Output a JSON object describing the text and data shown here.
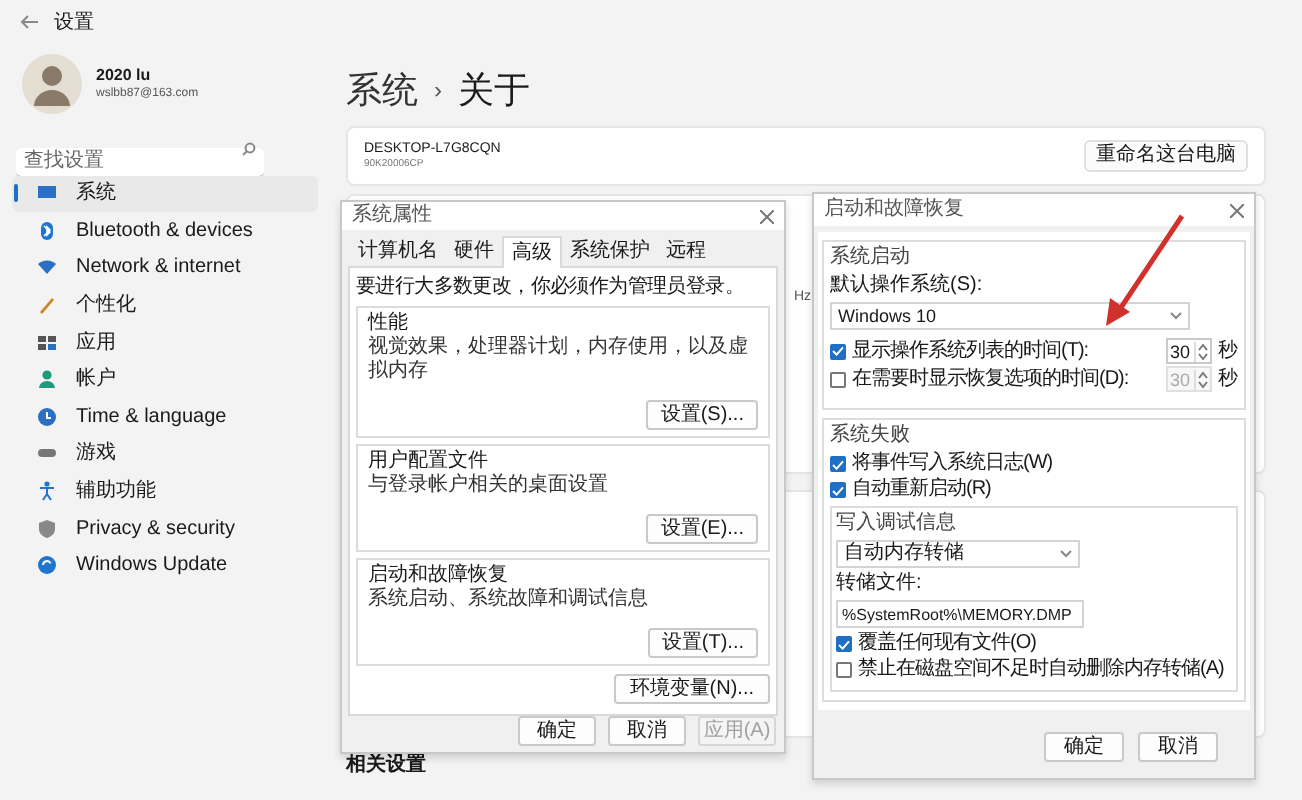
{
  "window": {
    "title": "设置"
  },
  "profile": {
    "name": "2020 lu",
    "email": "wslbb87@163.com"
  },
  "search": {
    "placeholder": "查找设置"
  },
  "nav": [
    {
      "label": "系统",
      "kind": "system",
      "selected": true
    },
    {
      "label": "Bluetooth & devices",
      "kind": "bluetooth",
      "selected": false
    },
    {
      "label": "Network & internet",
      "kind": "network",
      "selected": false
    },
    {
      "label": "个性化",
      "kind": "personalize",
      "selected": false
    },
    {
      "label": "应用",
      "kind": "apps",
      "selected": false
    },
    {
      "label": "帐户",
      "kind": "accounts",
      "selected": false
    },
    {
      "label": "Time & language",
      "kind": "time",
      "selected": false
    },
    {
      "label": "游戏",
      "kind": "gaming",
      "selected": false
    },
    {
      "label": "辅助功能",
      "kind": "accessibility",
      "selected": false
    },
    {
      "label": "Privacy & security",
      "kind": "privacy",
      "selected": false
    },
    {
      "label": "Windows Update",
      "kind": "update",
      "selected": false
    }
  ],
  "breadcrumb": {
    "parent": "系统",
    "separator": "›",
    "current": "关于"
  },
  "device_card": {
    "name": "DESKTOP-L7G8CQN",
    "model": "90K20006CP",
    "button": "重命名这台电脑"
  },
  "background_text": "Hz",
  "related_heading": "相关设置",
  "system_properties": {
    "title": "系统属性",
    "tabs": [
      {
        "label": "计算机名",
        "selected": false
      },
      {
        "label": "硬件",
        "selected": false
      },
      {
        "label": "高级",
        "selected": true
      },
      {
        "label": "系统保护",
        "selected": false
      },
      {
        "label": "远程",
        "selected": false
      }
    ],
    "notice": "要进行大多数更改，你必须作为管理员登录。",
    "groups": [
      {
        "title": "性能",
        "description": "视觉效果，处理器计划，内存使用，以及虚拟内存",
        "button": "设置(S)..."
      },
      {
        "title": "用户配置文件",
        "description": "与登录帐户相关的桌面设置",
        "button": "设置(E)..."
      },
      {
        "title": "启动和故障恢复",
        "description": "系统启动、系统故障和调试信息",
        "button": "设置(T)..."
      }
    ],
    "env_button": "环境变量(N)...",
    "buttons": [
      {
        "label": "确定",
        "disabled": false
      },
      {
        "label": "取消",
        "disabled": false
      },
      {
        "label": "应用(A)",
        "disabled": true
      }
    ]
  },
  "startup_recovery": {
    "title": "启动和故障恢复",
    "system_startup": {
      "title": "系统启动",
      "default_os_label": "默认操作系统(S):",
      "default_os": "Windows 10",
      "timers": [
        {
          "label": "显示操作系统列表的时间(T):",
          "checked": true,
          "value": "30",
          "unit": "秒"
        },
        {
          "label": "在需要时显示恢复选项的时间(D):",
          "checked": false,
          "value": "30",
          "unit": "秒"
        }
      ]
    },
    "system_failure": {
      "title": "系统失败",
      "options": [
        {
          "label": "将事件写入系统日志(W)",
          "checked": true
        },
        {
          "label": "自动重新启动(R)",
          "checked": true
        }
      ],
      "debug": {
        "title": "写入调试信息",
        "type": "自动内存转储",
        "dump_file_label": "转储文件:",
        "dump_file": "%SystemRoot%\\MEMORY.DMP",
        "options": [
          {
            "label": "覆盖任何现有文件(O)",
            "checked": true
          },
          {
            "label": "禁止在磁盘空间不足时自动删除内存转储(A)",
            "checked": false
          }
        ]
      }
    },
    "buttons": [
      {
        "label": "确定",
        "disabled": false
      },
      {
        "label": "取消",
        "disabled": false
      }
    ]
  }
}
